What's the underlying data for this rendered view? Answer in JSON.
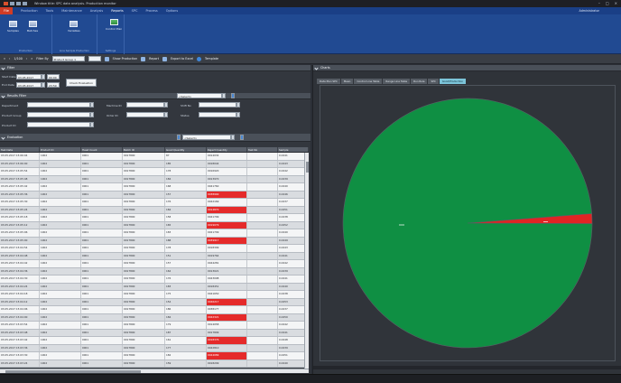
{
  "window": {
    "title": "Window title: SPC data analysis. Production monitor"
  },
  "ribbon_tabs": {
    "file": "File",
    "tabs": [
      "Production",
      "Tools",
      "Maintenance",
      "Analysis",
      "Reports",
      "SPC",
      "Process",
      "Options"
    ],
    "active_index": 4,
    "user": "Administrator"
  },
  "ribbon": {
    "group1": {
      "buttons": [
        "Samples",
        "Batches"
      ],
      "label": "Production"
    },
    "group2": {
      "buttons": [
        "Variables"
      ],
      "label": "Line Sample Production"
    },
    "group3": {
      "buttons": [
        "Control Plan"
      ],
      "label": "Settings"
    }
  },
  "toolbar": {
    "prev_first": "«",
    "prev": "‹",
    "page": "1/100",
    "next": "›",
    "next_last": "»",
    "filter_label": "Filter By",
    "filter_value": "Product Group 1",
    "show_prod_samples": "Show Production",
    "report": "Report",
    "export": "Export to Excel",
    "template": "Template"
  },
  "filter_panel": {
    "title": "Filter",
    "start_label": "Start Date",
    "start_date": "03.05.2017",
    "start_time": "00:00",
    "end_label": "End Date",
    "end_date": "03.05.2017",
    "end_time": "23:59",
    "check_button": "Check Evaluation"
  },
  "sample_panel": {
    "title": "Results Filter",
    "select_value": "<Select>",
    "rows": [
      {
        "l1": "Department",
        "l2": "Machine ID",
        "l3": "Shift No"
      },
      {
        "l1": "Product Group",
        "l2": "Order ID",
        "l3": "Status"
      },
      {
        "l1": "Product ID"
      }
    ]
  },
  "evaluation_panel": {
    "title": "Evaluation",
    "select_value": "<Select>"
  },
  "table": {
    "columns": [
      "Test Date",
      "Product ID",
      "Head Count",
      "Batch ID",
      "Good Quantity",
      "Reject Quantity",
      "Test No",
      "Sample"
    ],
    "rows": [
      [
        "03.05.2017 15:06:04",
        "1002",
        "0001",
        "0017890",
        "87",
        "0014034",
        "",
        "0.0241"
      ],
      [
        "03.05.2017 15:06:00",
        "1002",
        "0001",
        "0017890",
        "185",
        "0018044",
        "",
        "0.0243"
      ],
      [
        "03.05.2017 15:05:54",
        "1002",
        "0001",
        "0017890",
        "178",
        "0016920",
        "",
        "0.0242"
      ],
      [
        "03.05.2017 15:05:48",
        "1002",
        "0001",
        "0017890",
        "184",
        "0013970",
        "",
        "0.0239"
      ],
      [
        "03.05.2017 15:05:42",
        "1002",
        "0001",
        "0017890",
        "168",
        "0041760",
        "",
        "0.0240"
      ],
      [
        "03.05.2017 15:05:36",
        "1002",
        "0001",
        "0017890",
        "157",
        "0038900",
        "red",
        "0.0246"
      ],
      [
        "03.05.2017 15:05:30",
        "1002",
        "0001",
        "0017890",
        "176",
        "0042169",
        "",
        "0.0237"
      ],
      [
        "03.05.2017 15:05:24",
        "1002",
        "0001",
        "0017890",
        "184",
        "0014870",
        "red",
        "0.0251"
      ],
      [
        "03.05.2017 15:05:18",
        "1002",
        "0001",
        "0017890",
        "158",
        "0041799",
        "",
        "0.0238"
      ],
      [
        "03.05.2017 15:05:12",
        "1002",
        "0001",
        "0017890",
        "165",
        "0019079",
        "red",
        "0.0252"
      ],
      [
        "03.05.2017 15:05:06",
        "1002",
        "0001",
        "0017890",
        "183",
        "0021709",
        "",
        "0.0240"
      ],
      [
        "03.05.2017 15:05:00",
        "1002",
        "0001",
        "0017890",
        "188",
        "0039917",
        "red",
        "0.0249"
      ],
      [
        "03.05.2017 15:04:54",
        "1002",
        "0001",
        "0017890",
        "178",
        "0018399",
        "",
        "0.0243"
      ],
      [
        "03.05.2017 15:04:48",
        "1002",
        "0001",
        "0017890",
        "151",
        "0019764",
        "",
        "0.0241"
      ],
      [
        "03.05.2017 15:04:42",
        "1002",
        "0001",
        "0017890",
        "157",
        "0044281",
        "",
        "0.0242"
      ],
      [
        "03.05.2017 15:04:36",
        "1002",
        "0001",
        "0017890",
        "162",
        "0013021",
        "",
        "0.0239"
      ],
      [
        "03.05.2017 15:04:30",
        "1002",
        "0001",
        "0017890",
        "176",
        "0043098",
        "",
        "0.0241"
      ],
      [
        "03.05.2017 15:04:24",
        "1002",
        "0001",
        "0017890",
        "183",
        "0018451",
        "",
        "0.0240"
      ],
      [
        "03.05.2017 15:04:18",
        "1002",
        "0001",
        "0017890",
        "175",
        "0041650",
        "",
        "0.0238"
      ],
      [
        "03.05.2017 15:04:12",
        "1002",
        "0001",
        "0017890",
        "154",
        "0046217",
        "red",
        "0.0253"
      ],
      [
        "03.05.2017 15:04:06",
        "1002",
        "0001",
        "0017890",
        "186",
        "0038177",
        "",
        "0.0237"
      ],
      [
        "03.05.2017 15:04:00",
        "1002",
        "0001",
        "0017890",
        "184",
        "0042321",
        "red",
        "0.0250"
      ],
      [
        "03.05.2017 15:03:54",
        "1002",
        "0001",
        "0017890",
        "179",
        "0014058",
        "",
        "0.0242"
      ],
      [
        "03.05.2017 15:03:48",
        "1002",
        "0001",
        "0017890",
        "187",
        "0017899",
        "",
        "0.0241"
      ],
      [
        "03.05.2017 15:03:42",
        "1002",
        "0001",
        "0017890",
        "161",
        "0018376",
        "red",
        "0.0248"
      ],
      [
        "03.05.2017 15:03:36",
        "1002",
        "0001",
        "0017890",
        "177",
        "0042810",
        "",
        "0.0239"
      ],
      [
        "03.05.2017 15:03:30",
        "1002",
        "0001",
        "0017890",
        "182",
        "0044089",
        "red",
        "0.0251"
      ],
      [
        "03.05.2017 15:03:24",
        "1002",
        "0001",
        "0017890",
        "159",
        "0018209",
        "",
        "0.0240"
      ]
    ]
  },
  "right_panel": {
    "title": "Charts",
    "tabs": [
      "Data Plan SPC",
      "Mean",
      "Control Line Table",
      "Range Line Table",
      "Run Rule",
      "SPC",
      "Good/Production"
    ],
    "active_tab": 6
  },
  "chart_data": {
    "type": "pie",
    "slices": [
      {
        "value": 98.7,
        "color": "#0f8f43"
      },
      {
        "value": 1.3,
        "color": "#e02424"
      }
    ],
    "data_labels": [
      "",
      ""
    ]
  },
  "colors": {
    "ribbon": "#214a92",
    "good": "#0f8f43",
    "bad": "#e02424",
    "active_tab": "#7cc4d9"
  }
}
